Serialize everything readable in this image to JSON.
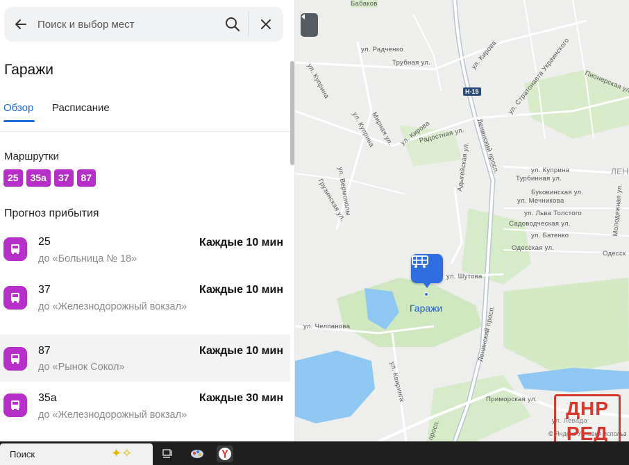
{
  "search": {
    "placeholder": "Поиск и выбор мест"
  },
  "stop": {
    "title": "Гаражи"
  },
  "tabs": [
    {
      "label": "Обзор",
      "active": true
    },
    {
      "label": "Расписание",
      "active": false
    }
  ],
  "routes_section": {
    "label": "Маршрутки",
    "routes": [
      "25",
      "35а",
      "37",
      "87"
    ],
    "color": "#b72fc9"
  },
  "arrivals_section": {
    "label": "Прогноз прибытия",
    "items": [
      {
        "route": "25",
        "destination": "до «Больница № 18»",
        "frequency": "Каждые 10 мин"
      },
      {
        "route": "37",
        "destination": "до «Железнодорожный вокзал»",
        "frequency": "Каждые 10 мин"
      },
      {
        "route": "87",
        "destination": "до «Рынок Сокол»",
        "frequency": "Каждые 10 мин"
      },
      {
        "route": "35а",
        "destination": "до «Железнодорожный вокзал»",
        "frequency": "Каждые 30 мин"
      }
    ]
  },
  "map": {
    "stop_name": "Гаражи",
    "road_shield": "Н-15",
    "streets": {
      "babakov": "Бабаков",
      "radchenko": "ул. Радченко",
      "trubnaya": "Трубная ул.",
      "kuprina_top": "ул. Куприна",
      "kirova_top": "ул. Кирова",
      "stratonavta": "ул. Стратонавта Украинского",
      "pionerskaya": "Пионерская ул.",
      "kuprina_mid": "ул. Куприна",
      "mirnaya": "Мирная ул.",
      "kirova_mid": "ул. Кирова",
      "radostnaya": "Радостная ул.",
      "leninsky_top": "Ленинский просп.",
      "vermonolya": "ул. Вермонолы",
      "gruzinskaya": "Грузинская ул.",
      "adygeiskaya": "Адыгейская ул.",
      "kuprina_right": "ул. Куприна",
      "turbinnaya": "Турбинная ул.",
      "bukovinskaya": "Буковинская ул.",
      "mechnikova": "ул. Мечникова",
      "lva_tolstogo": "ул. Льва Толстого",
      "sadovodcheskaya": "Садоводческая ул.",
      "batenko": "ул. Батенко",
      "odesskaya": "Одесская ул.",
      "odesskaya_right": "Одесск",
      "molodezhnaya": "Молодежная ул.",
      "lenin_edge": "ЛЕНИ",
      "shutova": "ул. Шутова",
      "chelpanova": "ул. Челпанова",
      "leninsky_low": "Ленинский просп.",
      "kviringa": "ул. Квиринга",
      "primorskaya": "Приморская ул.",
      "levada": "ул. Левада",
      "prosp": "просп."
    },
    "footer": "© Яндекс   Условия использ"
  },
  "watermark": {
    "line1": "ДНР",
    "line2": "РЕД"
  },
  "taskbar": {
    "search_label": "Поиск"
  }
}
